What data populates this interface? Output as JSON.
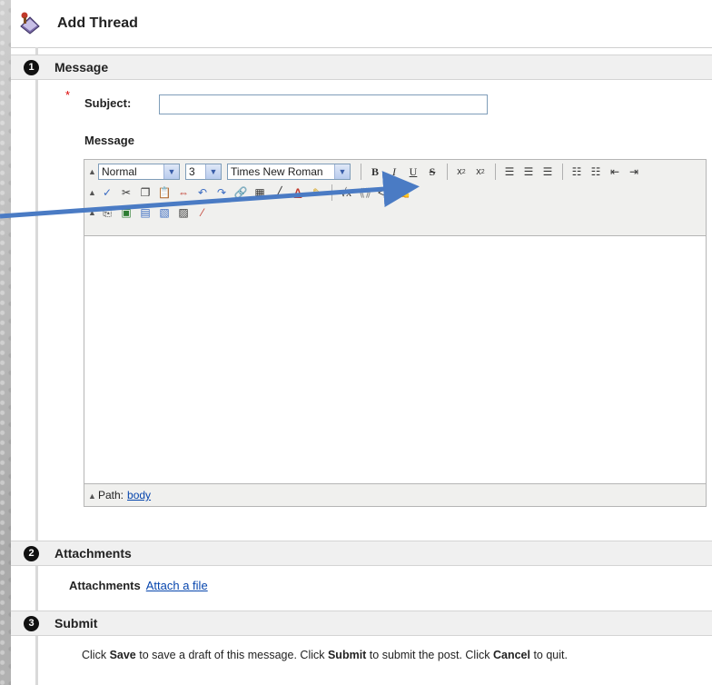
{
  "header": {
    "title": "Add Thread"
  },
  "sections": [
    {
      "number": "1",
      "title": "Message"
    },
    {
      "number": "2",
      "title": "Attachments"
    },
    {
      "number": "3",
      "title": "Submit"
    }
  ],
  "message": {
    "required_mark": "*",
    "subject_label": "Subject:",
    "subject_value": "",
    "message_label": "Message"
  },
  "editor": {
    "format_select": "Normal",
    "size_select": "3",
    "font_select": "Times New Roman",
    "path_label": "Path:",
    "path_link": "body",
    "content": ""
  },
  "attachments": {
    "label": "Attachments",
    "link": "Attach a file"
  },
  "submit": {
    "t1": "Click ",
    "b1": "Save",
    "t2": " to save a draft of this message. Click ",
    "b2": "Submit",
    "t3": " to submit the post. Click ",
    "b3": "Cancel",
    "t4": " to quit."
  },
  "colors": {
    "arrow": "#4a7bc4",
    "link": "#0645ad",
    "required": "#dd0000"
  }
}
